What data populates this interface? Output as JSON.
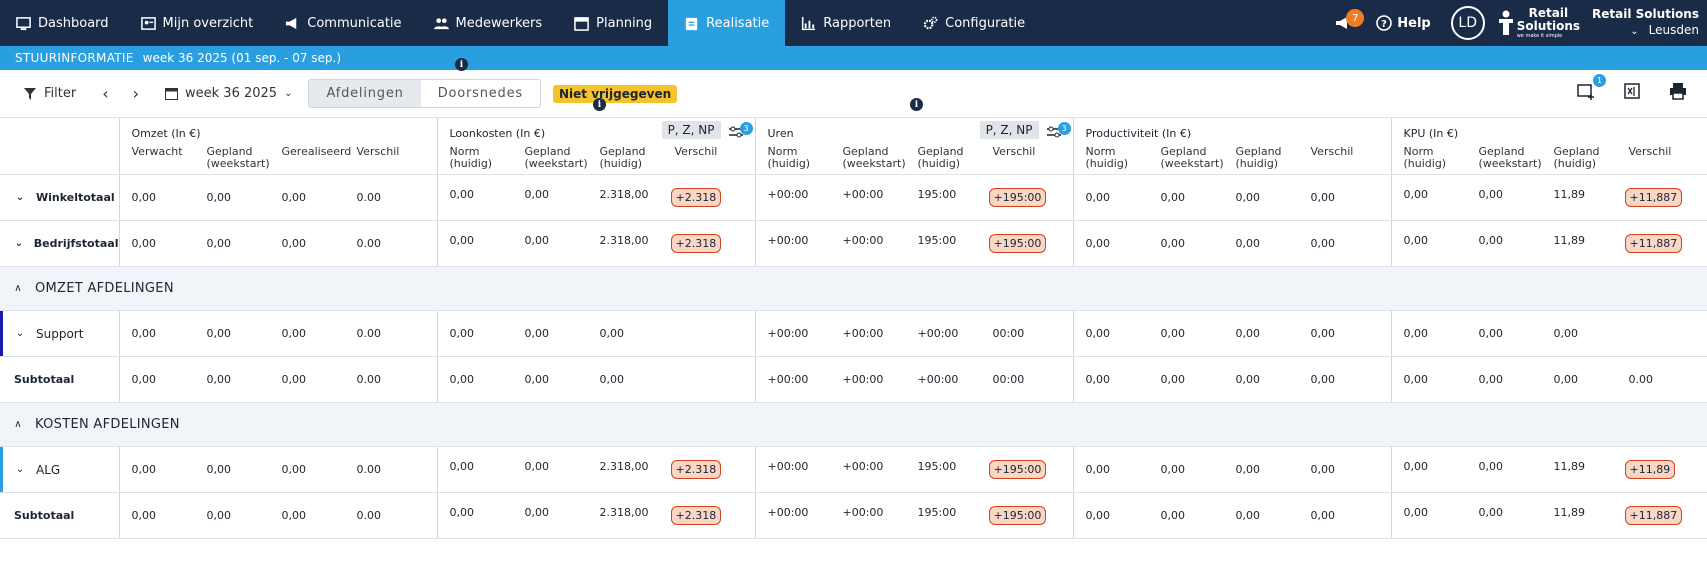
{
  "nav": {
    "items": [
      {
        "label": "Dashboard",
        "icon": "dashboard-icon"
      },
      {
        "label": "Mijn overzicht",
        "icon": "profile-card-icon"
      },
      {
        "label": "Communicatie",
        "icon": "megaphone-icon"
      },
      {
        "label": "Medewerkers",
        "icon": "people-icon"
      },
      {
        "label": "Planning",
        "icon": "calendar-icon"
      },
      {
        "label": "Realisatie",
        "icon": "clipboard-icon",
        "active": true
      },
      {
        "label": "Rapporten",
        "icon": "bar-chart-icon"
      },
      {
        "label": "Configuratie",
        "icon": "gears-icon"
      }
    ],
    "notification_count": "7",
    "help_label": "Help",
    "avatar_initials": "LD",
    "logo_line1": "Retail",
    "logo_line2": "Solutions",
    "logo_tagline": "we make it simple",
    "company": "Retail Solutions",
    "store": "Leusden",
    "accent_color": "#2a9fe0",
    "bg_color": "#1a2b47"
  },
  "subbar": {
    "title": "STUURINFORMATIE",
    "period": "week 36 2025 (01 sep. - 07 sep.)"
  },
  "toolbar": {
    "filter_label": "Filter",
    "week_label": "week 36 2025",
    "seg_afdelingen": "Afdelingen",
    "seg_doorsnedes": "Doorsnedes",
    "status_pill": "Niet vrijgegeven",
    "add_widget_badge": "1"
  },
  "groups": [
    {
      "title": "Omzet (In €)",
      "cols": [
        "Verwacht",
        "Gepland (weekstart)",
        "Gerealiseerd",
        "Verschil"
      ],
      "tag": "",
      "badge": ""
    },
    {
      "title": "Loonkosten (In €)",
      "cols": [
        "Norm (huidig)",
        "Gepland (weekstart)",
        "Gepland (huidig)",
        "Verschil"
      ],
      "tag": "P, Z, NP",
      "badge": "3"
    },
    {
      "title": "Uren",
      "cols": [
        "Norm (huidig)",
        "Gepland (weekstart)",
        "Gepland (huidig)",
        "Verschil"
      ],
      "tag": "P, Z, NP",
      "badge": "3"
    },
    {
      "title": "Productiviteit (In €)",
      "cols": [
        "Norm (huidig)",
        "Gepland (weekstart)",
        "Gepland (huidig)",
        "Verschil"
      ],
      "tag": "",
      "badge": ""
    },
    {
      "title": "KPU (In €)",
      "cols": [
        "Norm (huidig)",
        "Gepland (weekstart)",
        "Gepland (huidig)",
        "Verschil"
      ],
      "tag": "",
      "badge": ""
    }
  ],
  "rows": [
    {
      "type": "data",
      "label": "Winkeltotaal",
      "chevron": "v",
      "bold": true,
      "values": [
        [
          "0,00",
          "0,00",
          "0,00",
          "0.00"
        ],
        [
          "0,00",
          "0,00",
          "2.318,00",
          "+2.318"
        ],
        [
          "+00:00",
          "+00:00",
          "195:00",
          "+195:00"
        ],
        [
          "0,00",
          "0,00",
          "0,00",
          "0,00"
        ],
        [
          "0,00",
          "0,00",
          "11,89",
          "+11,887"
        ]
      ]
    },
    {
      "type": "data",
      "label": "Bedrijfstotaal",
      "chevron": "v",
      "bold": true,
      "values": [
        [
          "0,00",
          "0,00",
          "0,00",
          "0.00"
        ],
        [
          "0,00",
          "0,00",
          "2.318,00",
          "+2.318"
        ],
        [
          "+00:00",
          "+00:00",
          "195:00",
          "+195:00"
        ],
        [
          "0,00",
          "0,00",
          "0,00",
          "0,00"
        ],
        [
          "0,00",
          "0,00",
          "11,89",
          "+11,887"
        ]
      ]
    },
    {
      "type": "section",
      "label": "OMZET AFDELINGEN"
    },
    {
      "type": "data",
      "label": "Support",
      "chevron": "v",
      "bold": false,
      "stripe": "#1a1aa8",
      "values": [
        [
          "0,00",
          "0,00",
          "0,00",
          "0.00"
        ],
        [
          "0,00",
          "0,00",
          "0,00",
          ""
        ],
        [
          "+00:00",
          "+00:00",
          "+00:00",
          "00:00"
        ],
        [
          "0,00",
          "0,00",
          "0,00",
          "0,00"
        ],
        [
          "0,00",
          "0,00",
          "0,00",
          ""
        ]
      ]
    },
    {
      "type": "data",
      "label": "Subtotaal",
      "chevron": "",
      "bold": true,
      "values": [
        [
          "0,00",
          "0,00",
          "0,00",
          "0.00"
        ],
        [
          "0,00",
          "0,00",
          "0,00",
          ""
        ],
        [
          "+00:00",
          "+00:00",
          "+00:00",
          "00:00"
        ],
        [
          "0,00",
          "0,00",
          "0,00",
          "0,00"
        ],
        [
          "0,00",
          "0,00",
          "0,00",
          "0.00"
        ]
      ]
    },
    {
      "type": "section",
      "label": "KOSTEN AFDELINGEN"
    },
    {
      "type": "data",
      "label": "ALG",
      "chevron": "v",
      "bold": false,
      "stripe": "#2a9fe0",
      "values": [
        [
          "0,00",
          "0,00",
          "0,00",
          "0.00"
        ],
        [
          "0,00",
          "0,00",
          "2.318,00",
          "+2.318"
        ],
        [
          "+00:00",
          "+00:00",
          "195:00",
          "+195:00"
        ],
        [
          "0,00",
          "0,00",
          "0,00",
          "0,00"
        ],
        [
          "0,00",
          "0,00",
          "11,89",
          "+11,89"
        ]
      ]
    },
    {
      "type": "data",
      "label": "Subtotaal",
      "chevron": "",
      "bold": true,
      "values": [
        [
          "0,00",
          "0,00",
          "0,00",
          "0.00"
        ],
        [
          "0,00",
          "0,00",
          "2.318,00",
          "+2.318"
        ],
        [
          "+00:00",
          "+00:00",
          "195:00",
          "+195:00"
        ],
        [
          "0,00",
          "0,00",
          "0,00",
          "0,00"
        ],
        [
          "0,00",
          "0,00",
          "11,89",
          "+11,887"
        ]
      ]
    }
  ]
}
